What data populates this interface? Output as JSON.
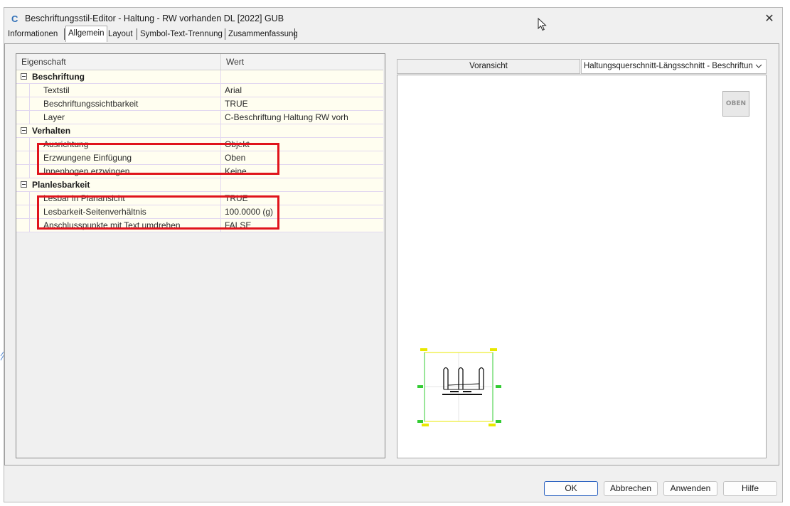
{
  "window": {
    "title": "Beschriftungsstil-Editor - Haltung - RW vorhanden DL [2022] GUB",
    "app_icon_glyph": "C",
    "close_glyph": "✕"
  },
  "tabs": [
    {
      "label": "Informationen"
    },
    {
      "label": "Allgemein",
      "active": true
    },
    {
      "label": "Layout"
    },
    {
      "label": "Symbol-Text-Trennung"
    },
    {
      "label": "Zusammenfassung"
    }
  ],
  "grid": {
    "header_property": "Eigenschaft",
    "header_value": "Wert",
    "categories": [
      {
        "label": "Beschriftung",
        "rows": [
          {
            "label": "Textstil",
            "value": "Arial"
          },
          {
            "label": "Beschriftungssichtbarkeit",
            "value": "TRUE"
          },
          {
            "label": "Layer",
            "value": "C-Beschriftung Haltung RW vorh"
          }
        ]
      },
      {
        "label": "Verhalten",
        "rows": [
          {
            "label": "Ausrichtung",
            "value": "Objekt"
          },
          {
            "label": "Erzwungene Einfügung",
            "value": "Oben"
          },
          {
            "label": "Innenbogen erzwingen",
            "value": "Keine"
          }
        ]
      },
      {
        "label": "Planlesbarkeit",
        "rows": [
          {
            "label": "Lesbar in Planansicht",
            "value": "TRUE"
          },
          {
            "label": "Lesbarkeit-Seitenverhältnis",
            "value": "100.0000 (g)"
          },
          {
            "label": "Anschlusspunkte mit Text umdrehen",
            "value": "FALSE"
          }
        ]
      }
    ]
  },
  "preview": {
    "view_label": "Voransicht",
    "selector_value": "Haltungsquerschnitt-Längsschnitt - Beschriftungsstil",
    "view_cube_label": "OBEN"
  },
  "buttons": {
    "ok": "OK",
    "cancel": "Abbrechen",
    "apply": "Anwenden",
    "help": "Hilfe"
  },
  "colors": {
    "highlight": "#e0141c",
    "grid_row_bg": "#fffef0",
    "preview_frame": "#33cc33",
    "preview_markers": "#e8e800"
  },
  "icons": {
    "collapse": "minus-box-icon",
    "dropdown": "chevron-down-icon",
    "cursor": "mouse-pointer-icon"
  }
}
